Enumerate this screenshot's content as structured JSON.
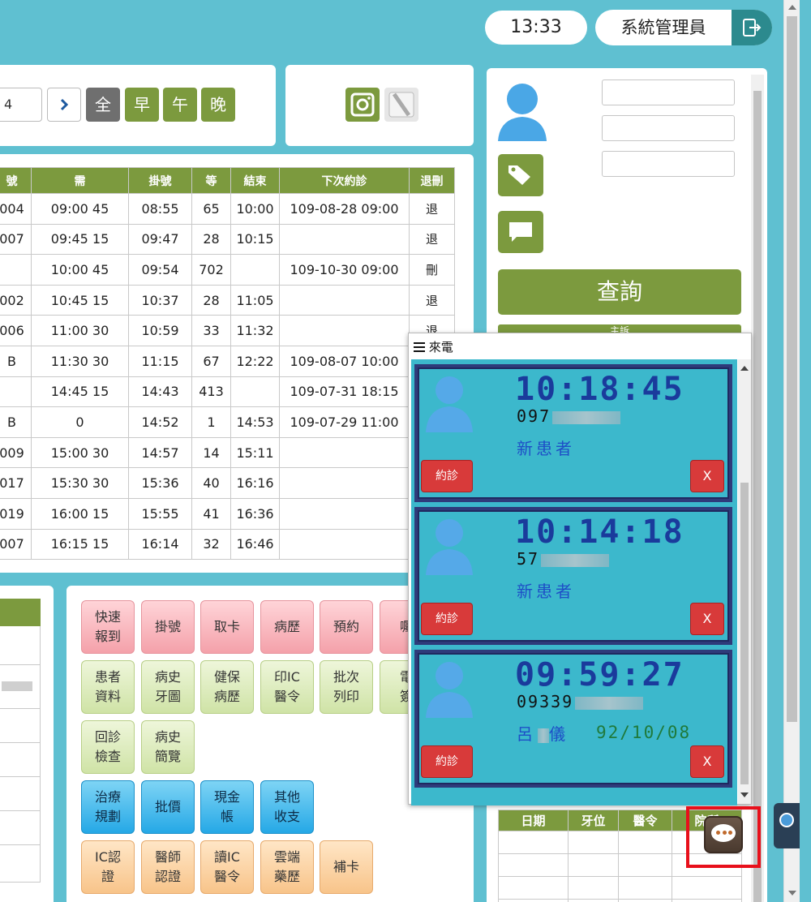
{
  "header": {
    "time": "13:33",
    "user": "系統管理員"
  },
  "filter": {
    "date_value": "4",
    "shifts": [
      "全",
      "早",
      "午",
      "晚"
    ],
    "active_shift": "全"
  },
  "schedule": {
    "headers": [
      "號",
      "需",
      "掛號",
      "等",
      "結束",
      "下次約診",
      "退刪"
    ],
    "rows": [
      {
        "no": "004",
        "need": "09:00 45",
        "reg": "08:55",
        "wait": "65",
        "wait_color": "red",
        "end": "10:00",
        "next": "109-08-28 09:00",
        "action": "退"
      },
      {
        "no": "007",
        "need": "09:45 15",
        "reg": "09:47",
        "wait": "28",
        "wait_color": "pink",
        "end": "10:15",
        "next": "",
        "action": "退"
      },
      {
        "no": "",
        "need": "10:00 45",
        "reg": "09:54",
        "wait": "702",
        "wait_color": "red",
        "end": "",
        "next": "109-10-30 09:00",
        "action": "刪"
      },
      {
        "no": "002",
        "need": "10:45 15",
        "reg": "10:37",
        "wait": "28",
        "wait_color": "pink",
        "end": "11:05",
        "next": "",
        "action": "退"
      },
      {
        "no": "006",
        "need": "11:00 30",
        "reg": "10:59",
        "wait": "33",
        "wait_color": "red",
        "end": "11:32",
        "next": "",
        "action": "退"
      },
      {
        "no": "B",
        "need": "11:30 30",
        "reg": "11:15",
        "wait": "67",
        "wait_color": "red",
        "end": "12:22",
        "next": "109-08-07 10:00",
        "action": ""
      },
      {
        "no": "",
        "need": "14:45 15",
        "reg": "14:43",
        "wait": "413",
        "wait_color": "red",
        "end": "",
        "next": "109-07-31 18:15",
        "action": ""
      },
      {
        "no": "B",
        "need": "0",
        "reg": "14:52",
        "wait": "1",
        "wait_color": "black",
        "end": "14:53",
        "next": "109-07-29 11:00",
        "action": ""
      },
      {
        "no": "009",
        "need": "15:00 30",
        "reg": "14:57",
        "wait": "14",
        "wait_color": "orange",
        "end": "15:11",
        "next": "",
        "action": ""
      },
      {
        "no": "017",
        "need": "15:30 30",
        "reg": "15:36",
        "wait": "40",
        "wait_color": "red",
        "end": "16:16",
        "next": "",
        "action": ""
      },
      {
        "no": "019",
        "need": "16:00 15",
        "reg": "15:55",
        "wait": "41",
        "wait_color": "red",
        "end": "16:36",
        "next": "",
        "action": ""
      },
      {
        "no": "007",
        "need": "16:15 15",
        "reg": "16:14",
        "wait": "32",
        "wait_color": "red",
        "end": "16:46",
        "next": "",
        "action": ""
      }
    ]
  },
  "side": {
    "query_label": "查詢",
    "strip_label": "主訴",
    "table_headers": [
      "日期",
      "牙位",
      "醫令",
      "院所"
    ]
  },
  "functions": [
    {
      "label": [
        "快速",
        "報到"
      ],
      "style": "pink"
    },
    {
      "label": [
        "掛號"
      ],
      "style": "pink"
    },
    {
      "label": [
        "取卡"
      ],
      "style": "pink"
    },
    {
      "label": [
        "病歷"
      ],
      "style": "pink"
    },
    {
      "label": [
        "預約"
      ],
      "style": "pink"
    },
    {
      "label": [
        "囑"
      ],
      "style": "pink"
    },
    {
      "label": [
        "患者",
        "資料"
      ],
      "style": "green"
    },
    {
      "label": [
        "病史",
        "牙圖"
      ],
      "style": "green"
    },
    {
      "label": [
        "健保",
        "病歷"
      ],
      "style": "green"
    },
    {
      "label": [
        "印IC",
        "醫令"
      ],
      "style": "green"
    },
    {
      "label": [
        "批次",
        "列印"
      ],
      "style": "green"
    },
    {
      "label": [
        "電",
        "簽"
      ],
      "style": "green"
    },
    {
      "label": [
        "回診",
        "檢查"
      ],
      "style": "green"
    },
    {
      "label": [
        "病史",
        "簡覽"
      ],
      "style": "green"
    },
    {
      "label": [
        "治療",
        "規劃"
      ],
      "style": "blue"
    },
    {
      "label": [
        "批價"
      ],
      "style": "blue"
    },
    {
      "label": [
        "現金",
        "帳"
      ],
      "style": "blue"
    },
    {
      "label": [
        "其他",
        "收支"
      ],
      "style": "blue"
    },
    {
      "label": [
        "IC認",
        "證"
      ],
      "style": "orange"
    },
    {
      "label": [
        "醫師",
        "認證"
      ],
      "style": "orange"
    },
    {
      "label": [
        "讀IC",
        "醫令"
      ],
      "style": "orange"
    },
    {
      "label": [
        "雲端",
        "藥歷"
      ],
      "style": "orange"
    },
    {
      "label": [
        "補卡"
      ],
      "style": "orange"
    }
  ],
  "popup": {
    "title": "來電",
    "calls": [
      {
        "time": "10:18:45",
        "phone": "097",
        "status": "新患者",
        "dob": "",
        "appt_label": "約診",
        "close_label": "X"
      },
      {
        "time": "10:14:18",
        "phone": "57",
        "status": "新患者",
        "dob": "",
        "appt_label": "約診",
        "close_label": "X"
      },
      {
        "time": "09:59:27",
        "phone": "09339",
        "status": "呂",
        "status_tail": "儀",
        "dob": "92/10/08",
        "appt_label": "約診",
        "close_label": "X"
      }
    ]
  },
  "colors": {
    "background": "#5fc0d1",
    "accent_green": "#7c9a3e",
    "alert_red": "#d83a3a",
    "highlight_red": "#e8101b"
  }
}
